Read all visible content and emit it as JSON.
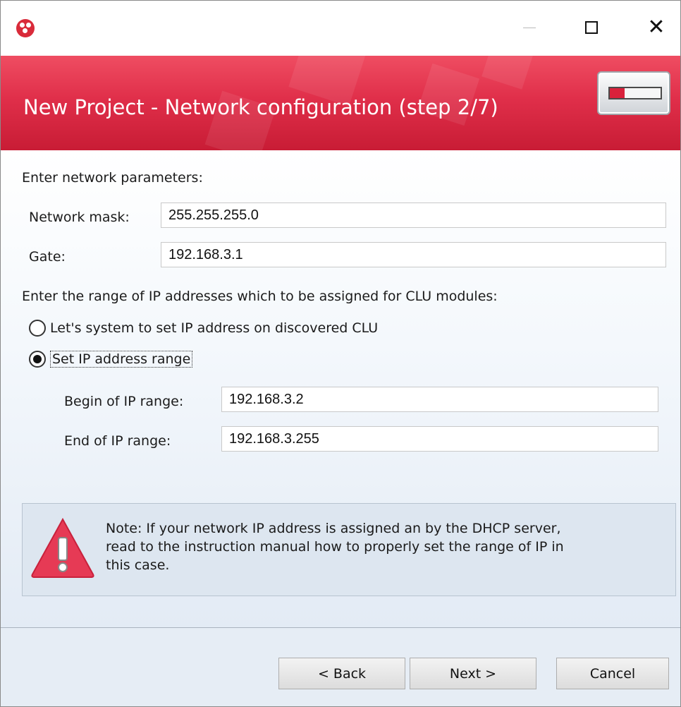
{
  "window": {
    "app_icon": "grenton-logo-icon",
    "controls": {
      "minimize": "—",
      "maximize": "☐",
      "close": "✕"
    }
  },
  "banner": {
    "title": "New Project - Network configuration (step 2/7)",
    "device_icon": "clu-device-icon",
    "progress_fraction": 0.29,
    "accent_color": "#e02f4a"
  },
  "form": {
    "intro": "Enter network parameters:",
    "mask_label": "Network mask:",
    "mask_value": "255.255.255.0",
    "gate_label": "Gate:",
    "gate_value": "192.168.3.1",
    "range_intro": "Enter the range of IP addresses which to be assigned for CLU modules:",
    "radio_auto_label": "Let's system to set IP address on discovered CLU",
    "radio_range_label": "Set IP address range",
    "selected_option": "Set IP address range",
    "begin_label": "Begin of IP range:",
    "begin_value": "192.168.3.2",
    "end_label": "End of IP range:",
    "end_value": "192.168.3.255"
  },
  "note": {
    "icon": "warning-icon",
    "text": "Note: If your network IP address is assigned an by the DHCP server,\nread to the instruction manual how to properly set the range of IP in\nthis case."
  },
  "footer": {
    "back_label": "< Back",
    "next_label": "Next >",
    "cancel_label": "Cancel"
  }
}
